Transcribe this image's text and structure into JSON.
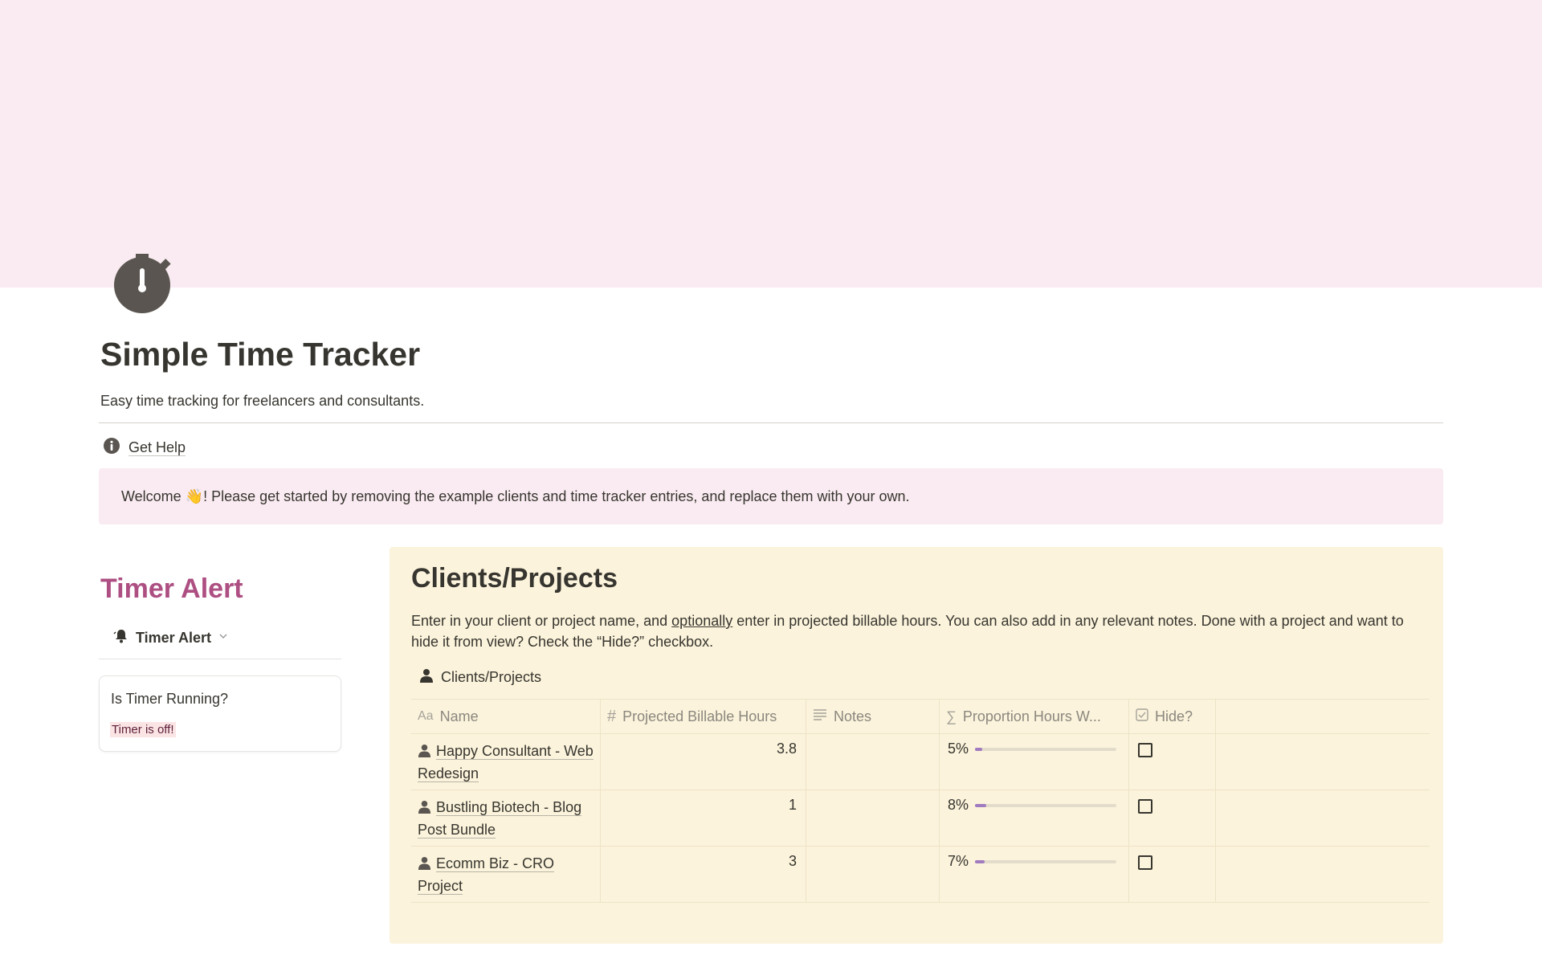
{
  "page": {
    "title": "Simple Time Tracker",
    "subtitle": "Easy time tracking for freelancers and consultants.",
    "icon": "stopwatch-icon",
    "cover_color": "#f9ebf1"
  },
  "help": {
    "label": "Get Help",
    "icon": "info-icon"
  },
  "callout": {
    "text": "Welcome 👋! Please get started by removing the example clients and time tracker entries, and replace them with your own."
  },
  "timer": {
    "heading": "Timer Alert",
    "heading_color": "#ad4f82",
    "view_tab_label": "Timer Alert",
    "card_title": "Is Timer Running?",
    "card_status": "Timer is off!"
  },
  "clients": {
    "heading": "Clients/Projects",
    "desc_before": "Enter in your client or project name, and ",
    "desc_underlined": "optionally",
    "desc_after": " enter in projected billable hours. You can also add in any relevant notes. Done with a project and want to hide it from view? Check the “Hide?” checkbox.",
    "db_title": "Clients/Projects",
    "columns": {
      "name": "Name",
      "projected": "Projected Billable Hours",
      "notes": "Notes",
      "proportion": "Proportion Hours W...",
      "hide": "Hide?"
    },
    "rows": [
      {
        "name": "Happy Consultant - Web Redesign",
        "projected": "3.8",
        "notes": "",
        "proportion_label": "5%",
        "proportion": 0.05,
        "hide": false
      },
      {
        "name": "Bustling Biotech - Blog Post Bundle",
        "projected": "1",
        "notes": "",
        "proportion_label": "8%",
        "proportion": 0.08,
        "hide": false
      },
      {
        "name": "Ecomm Biz - CRO Project",
        "projected": "3",
        "notes": "",
        "proportion_label": "7%",
        "proportion": 0.07,
        "hide": false
      }
    ],
    "progress_color": "#a17bc0",
    "panel_color": "#fbf3db"
  }
}
